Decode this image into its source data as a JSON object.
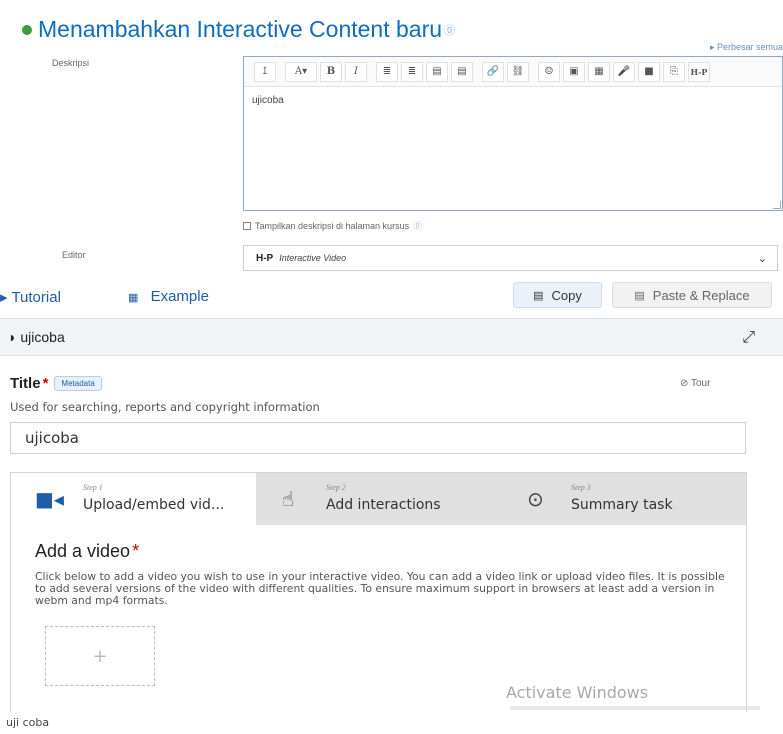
{
  "page": {
    "title": "Menambahkan Interactive Content baru",
    "expand_all": "▸ Perbesar semua"
  },
  "description": {
    "label": "Deskripsi",
    "content": "ujicoba",
    "toolbar": [
      "↥",
      "A▾",
      "B",
      "I",
      "≣",
      "≣",
      "▤",
      "▤",
      "🔗",
      "⛓",
      "☺",
      "▣",
      "▦",
      "🎤",
      "■",
      "⎘",
      "H-P"
    ],
    "show_on_course_page": "Tampilkan deskripsi di halaman kursus"
  },
  "editor": {
    "label": "Editor",
    "logo": "H-P",
    "value": "Interactive Video"
  },
  "h5p": {
    "tutorial_link": "Tutorial",
    "example_link": "Example",
    "copy_button": "Copy",
    "paste_button": "Paste & Replace",
    "content_name": "ujicoba",
    "title_label": "Title",
    "metadata_badge": "Metadata",
    "tour_label": "Tour",
    "title_description": "Used for searching, reports and copyright information",
    "title_value": "ujicoba",
    "steps": [
      {
        "step": "Step 1",
        "label": "Upload/embed vid...",
        "icon": "video-camera-icon"
      },
      {
        "step": "Step 2",
        "label": "Add interactions",
        "icon": "interactions-icon"
      },
      {
        "step": "Step 3",
        "label": "Summary task",
        "icon": "check-circle-icon"
      }
    ],
    "add_video_heading": "Add a video",
    "add_video_description": "Click below to add a video you wish to use in your interactive video. You can add a video link or upload video files. It is possible to add several versions of the video with different qualities. To ensure maximum support in browsers at least add a version in webm and mp4 formats.",
    "upload_plus": "+"
  },
  "overlay": {
    "activate_windows": "Activate Windows"
  },
  "caption": "uji coba",
  "colors": {
    "accent": "#0f6cbf",
    "link": "#1f5da6",
    "required": "#cc0000",
    "step_bar": "#e0e0e0"
  }
}
